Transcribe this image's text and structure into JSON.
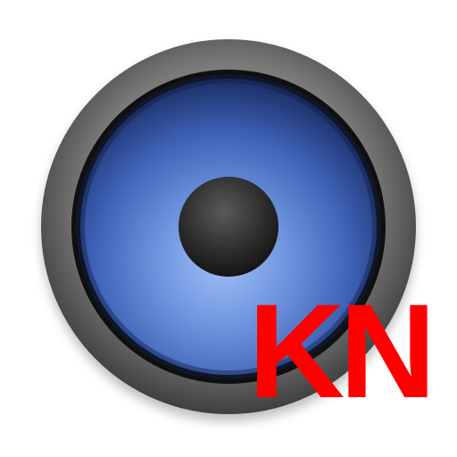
{
  "icon": {
    "name": "speaker-icon",
    "badge_text": "KN",
    "colors": {
      "rim_outer": "#6a6a6a",
      "rim_inner": "#3a3a3a",
      "cone_light": "#8fb1ee",
      "cone_mid": "#4f76c9",
      "cone_dark": "#21387a",
      "dust_cap": "#2f2f2f",
      "badge": "#ff0000"
    }
  }
}
